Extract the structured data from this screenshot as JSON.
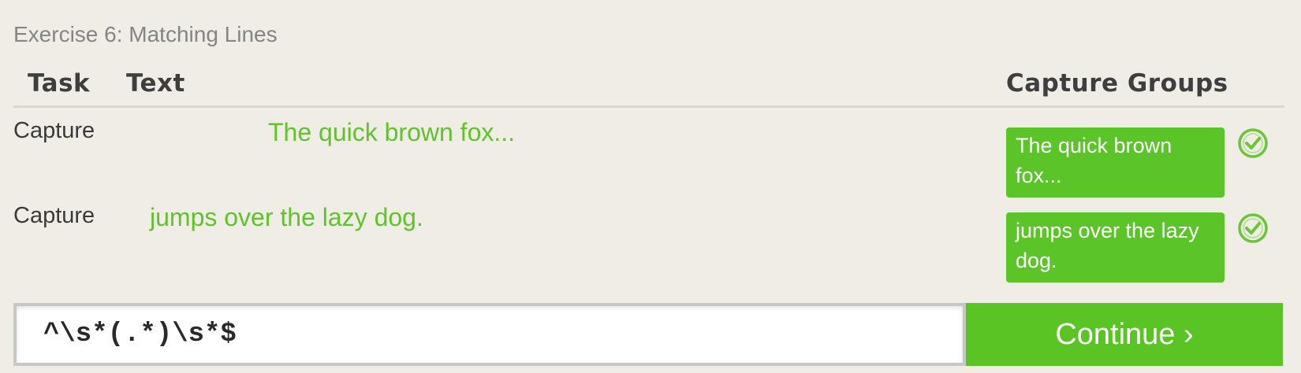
{
  "exercise": {
    "title": "Exercise 6: Matching Lines"
  },
  "table": {
    "headers": {
      "task": "Task",
      "text": "Text",
      "capture_groups": "Capture Groups"
    },
    "rows": [
      {
        "task": "Capture",
        "text": "The quick brown fox...",
        "capture_group": "The quick brown fox...",
        "status_icon": "check-circle-icon"
      },
      {
        "task": "Capture",
        "text": "jumps over the lazy dog.",
        "capture_group": "jumps over the lazy dog.",
        "status_icon": "check-circle-icon"
      }
    ]
  },
  "regex": {
    "value": "^\\s*(.*)\\s*$"
  },
  "continue_button": {
    "label": "Continue ›"
  },
  "colors": {
    "accent_green": "#5ac428",
    "background": "#efede6"
  }
}
